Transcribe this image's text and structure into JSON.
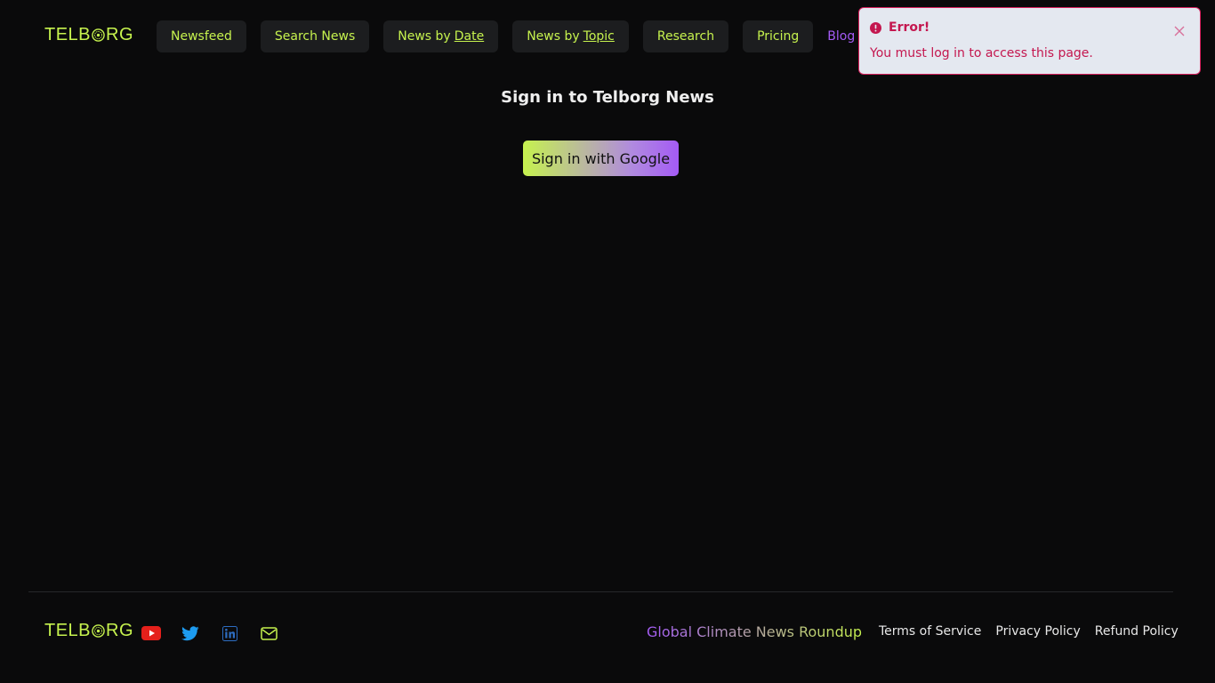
{
  "brand": {
    "name_left": "TELB",
    "name_right": "RG",
    "color": "#c6f24e"
  },
  "nav": {
    "items": [
      {
        "label": "Newsfeed"
      },
      {
        "label": "Search News"
      },
      {
        "label": "News by",
        "underline": "Date"
      },
      {
        "label": "News by",
        "underline": "Topic"
      },
      {
        "label": "Research"
      },
      {
        "label": "Pricing"
      }
    ],
    "blog_label": "Blog"
  },
  "toast": {
    "title": "Error!",
    "message": "You must log in to access this page.",
    "color": "#c4174f"
  },
  "signin": {
    "title": "Sign in to Telborg News",
    "google_button": "Sign in with Google"
  },
  "footer": {
    "social_icons": [
      "youtube-icon",
      "twitter-icon",
      "linkedin-icon",
      "mail-icon"
    ],
    "roundup_label": "Global Climate News Roundup",
    "links": [
      "Terms of Service",
      "Privacy Policy",
      "Refund Policy"
    ]
  },
  "colors": {
    "accent_green": "#c6f24e",
    "accent_purple": "#a45bf5",
    "background": "#0a0a0b"
  }
}
